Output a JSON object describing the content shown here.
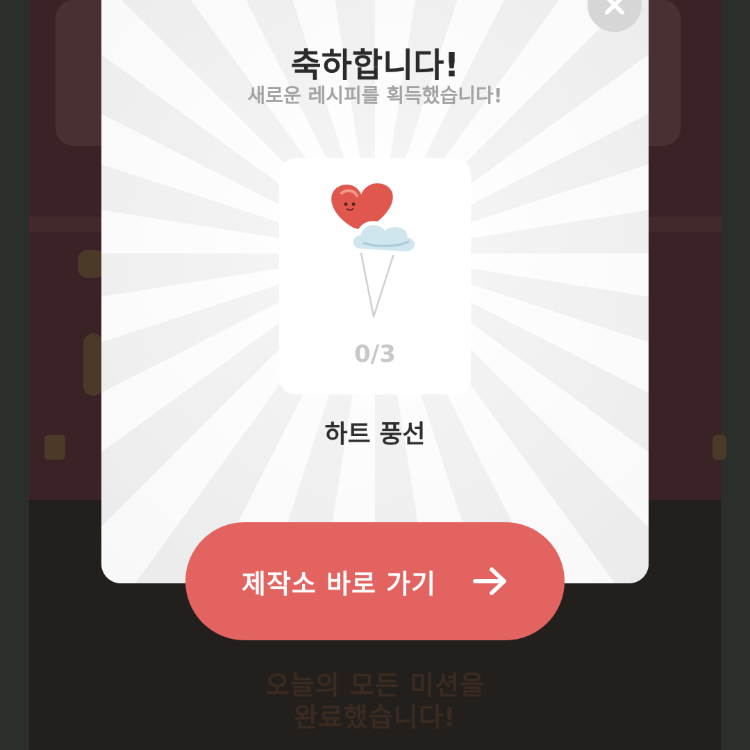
{
  "background": {
    "mission_line1": "오늘의 모든 미션을",
    "mission_line2": "완료했습니다!"
  },
  "modal": {
    "title": "축하합니다!",
    "subtitle": "새로운 레시피를 획득했습니다!",
    "item": {
      "name": "하트 풍선",
      "count": "0/3",
      "image": "heart-balloon-icon"
    },
    "close_icon": "close-icon"
  },
  "cta": {
    "label": "제작소 바로 가기",
    "icon": "arrow-right-icon"
  },
  "colors": {
    "accent": "#e2635f",
    "title": "#2b2b2b",
    "subtitle": "#a3a3a3"
  }
}
